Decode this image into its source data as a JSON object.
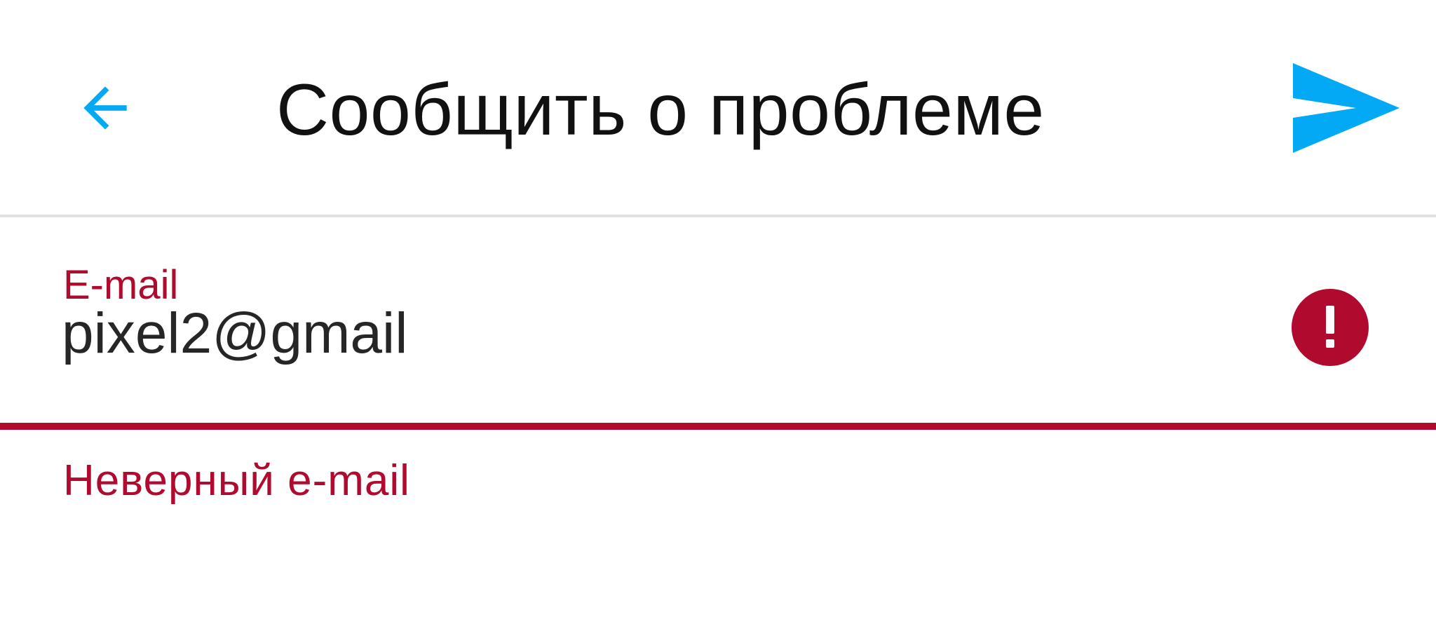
{
  "toolbar": {
    "title": "Сообщить о проблеме",
    "back_icon": "arrow-left-icon",
    "send_icon": "send-icon",
    "accent_color": "#03a9f4"
  },
  "email_field": {
    "label": "E-mail",
    "value": "pixel2@gmail",
    "error_icon": "error-exclamation-icon",
    "error_message": "Неверный e-mail",
    "error_color": "#b00a2e"
  }
}
